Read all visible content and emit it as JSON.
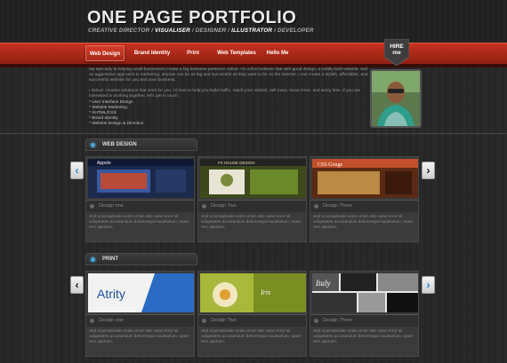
{
  "header": {
    "logo": "ONE PAGE PORTFOLIO",
    "tagline_parts": [
      "CREATIVE DIRECTOR / ",
      "VISUALISER",
      " / DESIGNER / ",
      "ILLUSTRATOR",
      " / DEVELOPER"
    ]
  },
  "nav": {
    "items": [
      {
        "label": "Web Design"
      },
      {
        "label": "Brand Identity"
      },
      {
        "label": "Print"
      },
      {
        "label": "Web Templates"
      },
      {
        "label": "Hello Me"
      }
    ],
    "hire_badge": {
      "line1": "HIRE",
      "line2": "me"
    }
  },
  "intro": {
    "paragraph1": "My specialty is helping small businesses create a big business presence online. I'm a firm believer that with good design, a solidly built website, and an aggressive approach to marketing, anyone can be as big and successful as they want to be on the internet. I can create a stylish, affordable, and successful website for you and your business.",
    "paragraph2": "I deliver creative solutions that work for you. I'd love to help you build traffic, reach your visitors, sell more, know more, and worry less. If you are interested in working together, let's get in touch.",
    "skills": [
      "* User Interface Design",
      "* Website Marketing",
      "* XHTML/CSS",
      "* Brand Identity",
      "* Website Design & Direction"
    ]
  },
  "sections": [
    {
      "title": "WEB DESIGN",
      "cards": [
        {
          "caption": "Design one",
          "thumb_text": "Appolo",
          "desc": "Sed ut perspiciatis unde omnis iste natus error sit voluptatem accusantium doloremque laudantium, totam rem aperiam,"
        },
        {
          "caption": "Design Two",
          "thumb_text": "FX HOUSE DESIGN",
          "desc": "Sed ut perspiciatis unde omnis iste natus error sit voluptatem accusantium doloremque laudantium, totam rem aperiam,"
        },
        {
          "caption": "Design Three",
          "thumb_text": "CSS Gouge",
          "desc": "Sed ut perspiciatis unde omnis iste natus error sit voluptatem accusantium doloremque laudantium, totam rem aperiam,"
        }
      ]
    },
    {
      "title": "PRINT",
      "cards": [
        {
          "caption": "Design one",
          "thumb_text": "Atrity",
          "desc": "Sed ut perspiciatis unde omnis iste natus error sit voluptatem accusantium doloremque laudantium, totam rem aperiam,"
        },
        {
          "caption": "Design Two",
          "thumb_text": "Iris",
          "desc": "Sed ut perspiciatis unde omnis iste natus error sit voluptatem accusantium doloremque laudantium, totam rem aperiam,"
        },
        {
          "caption": "Design Three",
          "thumb_text": "Italy",
          "desc": "Sed ut perspiciatis unde omnis iste natus error sit voluptatem accusantium doloremque laudantium, totam rem aperiam,"
        }
      ]
    }
  ],
  "arrows": {
    "left": "‹",
    "right": "›"
  },
  "colors": {
    "accent_red": "#c8321f",
    "accent_blue": "#4aa6d6",
    "background": "#262626"
  }
}
